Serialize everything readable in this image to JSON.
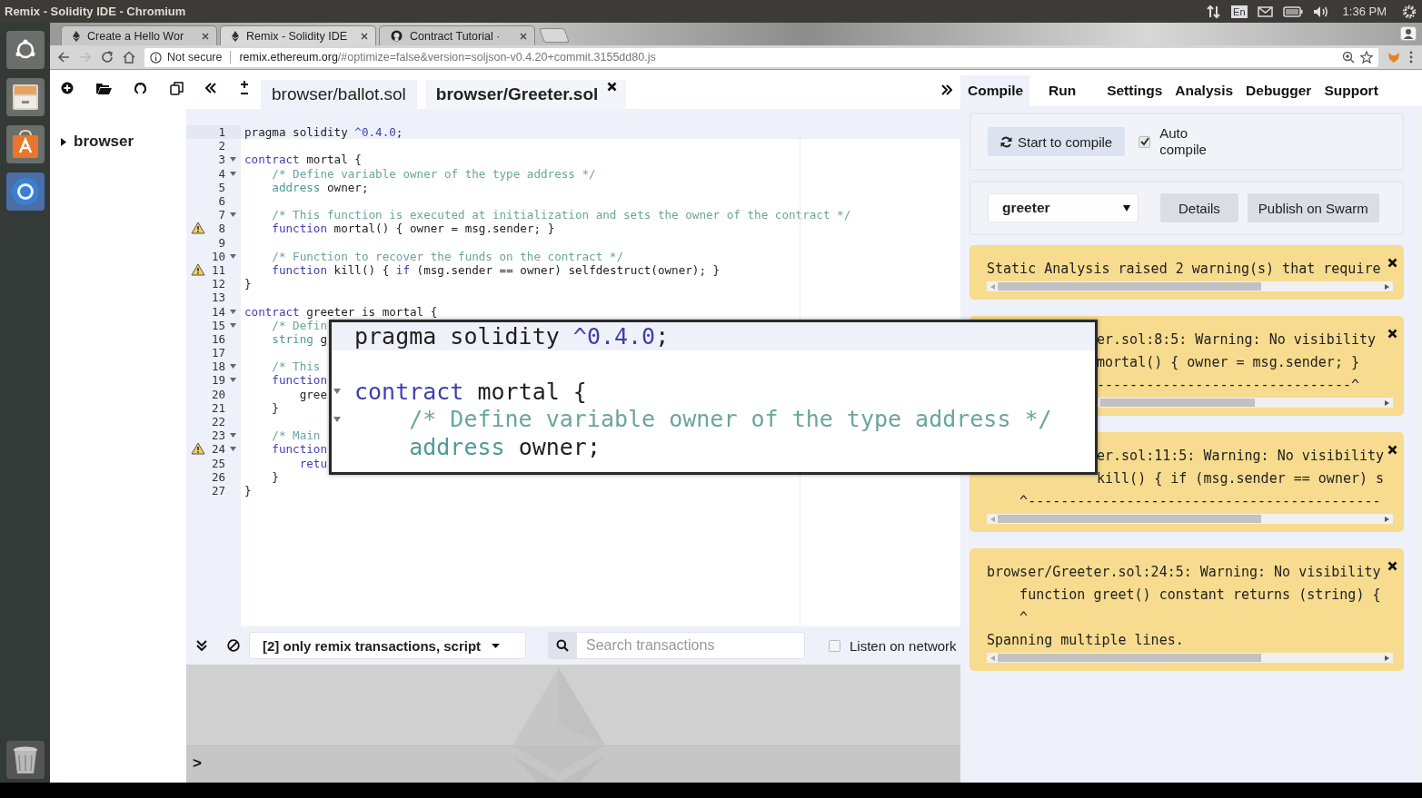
{
  "system_bar": {
    "title": "Remix - Solidity IDE - Chromium",
    "keyboard": "En",
    "clock": "1:36 PM"
  },
  "browser_tabs": [
    {
      "label": "Create a Hello Wor",
      "kind": "ethereum",
      "selected": false
    },
    {
      "label": "Remix - Solidity IDE",
      "kind": "ethereum",
      "selected": true
    },
    {
      "label": "Contract Tutorial ·",
      "kind": "github",
      "selected": false
    }
  ],
  "address_bar": {
    "security": "Not secure",
    "url": "remix.ethereum.org/#optimize=false&version=soljson-v0.4.20+commit.3155dd80.js"
  },
  "file_explorer": {
    "tree": [
      {
        "label": "browser",
        "expanded": false
      }
    ]
  },
  "editor_tabs": [
    {
      "label": "browser/ballot.sol",
      "selected": false
    },
    {
      "label": "browser/Greeter.sol",
      "selected": true
    }
  ],
  "code_lines": [
    {
      "number": "1",
      "fold": false,
      "warning": false,
      "current": true,
      "tokens": [
        {
          "kind": "plain",
          "text": "pragma solidity "
        },
        {
          "kind": "number",
          "text": "^0.4.0"
        },
        {
          "kind": "plain",
          "text": ";"
        }
      ]
    },
    {
      "number": "2",
      "fold": false,
      "warning": false,
      "current": false
    },
    {
      "number": "3",
      "fold": true,
      "warning": false,
      "current": false,
      "tokens": [
        {
          "kind": "keyword",
          "text": "contract"
        },
        {
          "kind": "plain",
          "text": " mortal {"
        }
      ]
    },
    {
      "number": "4",
      "fold": true,
      "warning": false,
      "current": false,
      "tokens": [
        {
          "kind": "comment",
          "text": "    /* Define variable owner of the type address */"
        }
      ]
    },
    {
      "number": "5",
      "fold": false,
      "warning": false,
      "current": false,
      "tokens": [
        {
          "kind": "type",
          "text": "    address"
        },
        {
          "kind": "plain",
          "text": " owner;"
        }
      ]
    },
    {
      "number": "6",
      "fold": false,
      "warning": false,
      "current": false
    },
    {
      "number": "7",
      "fold": true,
      "warning": false,
      "current": false,
      "tokens": [
        {
          "kind": "comment",
          "text": "    /* This function is executed at initialization and sets the owner of the contract */"
        }
      ]
    },
    {
      "number": "8",
      "fold": false,
      "warning": true,
      "current": false,
      "tokens": [
        {
          "kind": "keyword",
          "text": "    function"
        },
        {
          "kind": "plain",
          "text": " mortal() { owner = msg.sender; }"
        }
      ]
    },
    {
      "number": "9",
      "fold": false,
      "warning": false,
      "current": false
    },
    {
      "number": "10",
      "fold": true,
      "warning": false,
      "current": false,
      "tokens": [
        {
          "kind": "comment",
          "text": "    /* Function to recover the funds on the contract */"
        }
      ]
    },
    {
      "number": "11",
      "fold": false,
      "warning": true,
      "current": false,
      "tokens": [
        {
          "kind": "keyword",
          "text": "    function"
        },
        {
          "kind": "plain",
          "text": " kill() { "
        },
        {
          "kind": "keyword",
          "text": "if"
        },
        {
          "kind": "plain",
          "text": " (msg.sender == owner) selfdestruct(owner); }"
        }
      ]
    },
    {
      "number": "12",
      "fold": false,
      "warning": false,
      "current": false,
      "tokens": [
        {
          "kind": "plain",
          "text": "}"
        }
      ]
    },
    {
      "number": "13",
      "fold": false,
      "warning": false,
      "current": false
    },
    {
      "number": "14",
      "fold": true,
      "warning": false,
      "current": false,
      "tokens": [
        {
          "kind": "keyword",
          "text": "contract"
        },
        {
          "kind": "plain",
          "text": " greeter is mortal {"
        }
      ]
    },
    {
      "number": "15",
      "fold": true,
      "warning": false,
      "current": false,
      "tokens": [
        {
          "kind": "comment",
          "text": "    /* Defin"
        }
      ]
    },
    {
      "number": "16",
      "fold": false,
      "warning": false,
      "current": false,
      "tokens": [
        {
          "kind": "type",
          "text": "    string"
        },
        {
          "kind": "plain",
          "text": " g"
        }
      ]
    },
    {
      "number": "17",
      "fold": false,
      "warning": false,
      "current": false
    },
    {
      "number": "18",
      "fold": true,
      "warning": false,
      "current": false,
      "tokens": [
        {
          "kind": "comment",
          "text": "    /* This"
        }
      ]
    },
    {
      "number": "19",
      "fold": true,
      "warning": false,
      "current": false,
      "tokens": [
        {
          "kind": "keyword",
          "text": "    function"
        }
      ]
    },
    {
      "number": "20",
      "fold": false,
      "warning": false,
      "current": false,
      "tokens": [
        {
          "kind": "plain",
          "text": "        gree"
        }
      ]
    },
    {
      "number": "21",
      "fold": false,
      "warning": false,
      "current": false,
      "tokens": [
        {
          "kind": "plain",
          "text": "    }"
        }
      ]
    },
    {
      "number": "22",
      "fold": false,
      "warning": false,
      "current": false
    },
    {
      "number": "23",
      "fold": true,
      "warning": false,
      "current": false,
      "tokens": [
        {
          "kind": "comment",
          "text": "    /* Main"
        }
      ]
    },
    {
      "number": "24",
      "fold": true,
      "warning": true,
      "current": false,
      "tokens": [
        {
          "kind": "keyword",
          "text": "    function"
        }
      ]
    },
    {
      "number": "25",
      "fold": false,
      "warning": false,
      "current": false,
      "tokens": [
        {
          "kind": "keyword",
          "text": "        retu"
        }
      ]
    },
    {
      "number": "26",
      "fold": false,
      "warning": false,
      "current": false,
      "tokens": [
        {
          "kind": "plain",
          "text": "    }"
        }
      ]
    },
    {
      "number": "27",
      "fold": false,
      "warning": false,
      "current": false,
      "tokens": [
        {
          "kind": "plain",
          "text": "}"
        }
      ]
    }
  ],
  "magnifier": {
    "lines": [
      {
        "fold": false,
        "current": true,
        "tokens": [
          {
            "kind": "plain",
            "text": "pragma solidity "
          },
          {
            "kind": "number",
            "text": "^0.4.0"
          },
          {
            "kind": "plain",
            "text": ";"
          }
        ]
      },
      {
        "fold": false,
        "current": false
      },
      {
        "fold": true,
        "current": false,
        "tokens": [
          {
            "kind": "keyword",
            "text": "contract"
          },
          {
            "kind": "plain",
            "text": " mortal {"
          }
        ]
      },
      {
        "fold": true,
        "current": false,
        "tokens": [
          {
            "kind": "comment",
            "text": "    /* Define variable owner of the type address */"
          }
        ]
      },
      {
        "fold": false,
        "current": false,
        "tokens": [
          {
            "kind": "type",
            "text": "    address"
          },
          {
            "kind": "plain",
            "text": " owner;"
          }
        ]
      }
    ]
  },
  "right_tabs": [
    {
      "label": "Compile",
      "selected": true
    },
    {
      "label": "Run",
      "selected": false
    },
    {
      "label": "Settings",
      "selected": false
    },
    {
      "label": "Analysis",
      "selected": false
    },
    {
      "label": "Debugger",
      "selected": false
    },
    {
      "label": "Support",
      "selected": false
    }
  ],
  "compile": {
    "button": "Start to compile",
    "auto_compile": {
      "label": "Auto compile",
      "checked": true
    }
  },
  "contract": {
    "selected": "greeter",
    "buttons": [
      "Details",
      "Publish on Swarm"
    ]
  },
  "messages": [
    {
      "lines": [
        {
          "text": "Static Analysis raised 2 warning(s) that require",
          "covered": false
        }
      ]
    },
    {
      "lines": [
        {
          "text": "er.sol:8:5: Warning: No visibility",
          "covered": true
        },
        {
          "text": "mortal() { owner = msg.sender; }",
          "covered": true
        },
        {
          "text": "-------------------------------^",
          "covered": true
        }
      ]
    },
    {
      "lines": [
        {
          "text": "er.sol:11:5: Warning: No visibility",
          "covered": true
        },
        {
          "text": "kill() { if (msg.sender == owner) s",
          "covered": true
        },
        {
          "text": "    ^-------------------------------------------",
          "covered": false
        }
      ]
    },
    {
      "lines": [
        {
          "text": "browser/Greeter.sol:24:5: Warning: No visibility",
          "covered": false
        },
        {
          "text": "    function greet() constant returns (string) {",
          "covered": false
        },
        {
          "text": "    ^",
          "covered": false
        },
        {
          "text": "Spanning multiple lines.",
          "covered": false
        }
      ]
    }
  ],
  "terminal_toolbar": {
    "filter": "[2] only remix transactions, script",
    "search": {
      "placeholder": "Search transactions"
    },
    "listen": {
      "label": "Listen on network",
      "checked": false
    }
  },
  "terminal": {
    "prompt": ">"
  }
}
